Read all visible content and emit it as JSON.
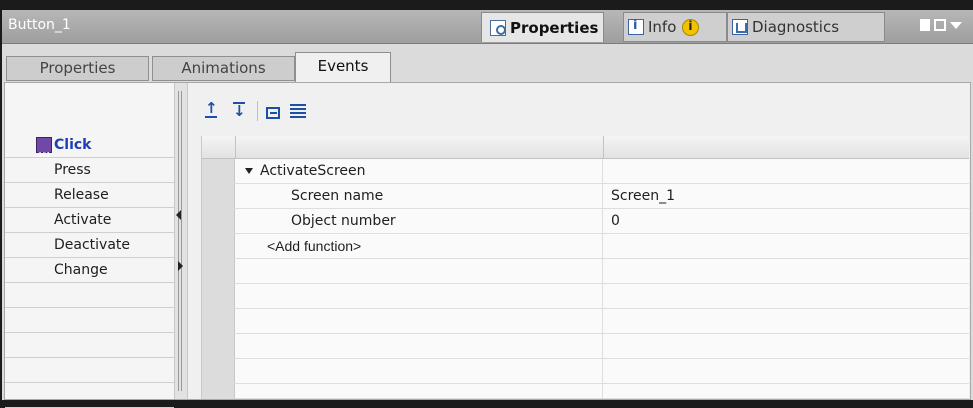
{
  "title": "Button_1",
  "inspector_tabs": {
    "properties": "Properties",
    "info": "Info",
    "diagnostics": "Diagnostics"
  },
  "subtabs": [
    "Properties",
    "Animations",
    "Events"
  ],
  "events": [
    "Click",
    "Press",
    "Release",
    "Activate",
    "Deactivate",
    "Change"
  ],
  "selected_event": "Click",
  "functions": [
    {
      "name": "ActivateScreen",
      "params": [
        {
          "name": "Screen name",
          "value": "Screen_1"
        },
        {
          "name": "Object number",
          "value": "0"
        }
      ]
    }
  ],
  "add_function": "<Add function>",
  "icons": {
    "properties": "magnifier-icon",
    "info": "info-icon",
    "warning": "warning-info-icon",
    "diagnostics": "diagnostics-icon",
    "click": "click-event-icon",
    "move_up": "move-up-icon",
    "move_down": "move-down-icon",
    "expand": "expand-icon",
    "list": "list-icon"
  },
  "colors": {
    "title_bar": "#a8a8a8",
    "selected_event_text": "#1d3fb5",
    "toolbar_icon": "#1c4fa6",
    "warning_badge": "#f2c200"
  }
}
